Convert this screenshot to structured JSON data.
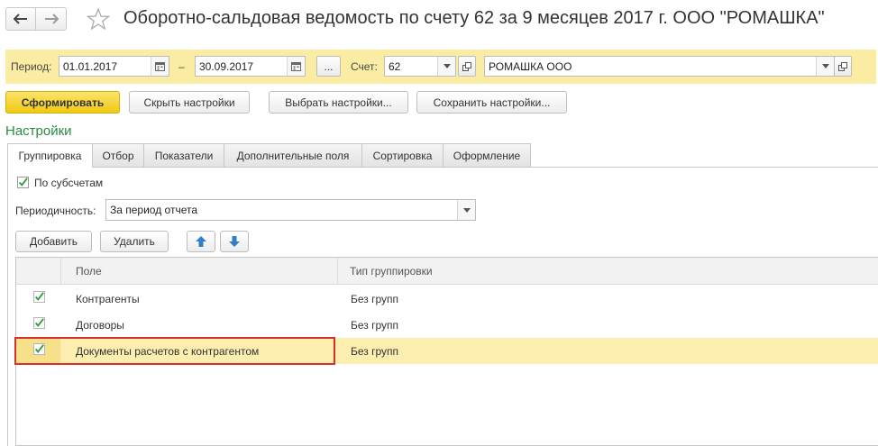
{
  "window": {
    "title": "Оборотно-сальдовая ведомость по счету 62 за 9 месяцев 2017 г. ООО \"РОМАШКА\"",
    "back_icon": "arrow-left-icon",
    "forward_icon": "arrow-right-icon",
    "favorite_icon": "star-icon"
  },
  "params": {
    "period_label": "Период:",
    "date_from": "01.01.2017",
    "dash": "–",
    "date_to": "30.09.2017",
    "ellipsis_label": "...",
    "account_label": "Счет:",
    "account_value": "62",
    "org_value": "РОМАШКА ООО"
  },
  "toolbar": {
    "generate": "Сформировать",
    "hide_settings": "Скрыть настройки",
    "choose_settings": "Выбрать настройки...",
    "save_settings": "Сохранить настройки..."
  },
  "settings": {
    "title": "Настройки",
    "tabs": [
      "Группировка",
      "Отбор",
      "Показатели",
      "Дополнительные поля",
      "Сортировка",
      "Оформление"
    ],
    "active_tab": "Группировка",
    "by_subaccounts_label": "По субсчетам",
    "by_subaccounts_checked": true,
    "periodicity_label": "Периодичность:",
    "periodicity_value": "За период отчета",
    "add_button": "Добавить",
    "delete_button": "Удалить",
    "move_up_icon": "arrow-up-icon",
    "move_down_icon": "arrow-down-icon"
  },
  "grouping_table": {
    "columns": [
      "Поле",
      "Тип группировки"
    ],
    "rows": [
      {
        "checked": true,
        "field": "Контрагенты",
        "type": "Без групп"
      },
      {
        "checked": true,
        "field": "Договоры",
        "type": "Без групп"
      },
      {
        "checked": true,
        "field": "Документы расчетов с контрагентом",
        "type": "Без групп",
        "selected": true
      }
    ]
  },
  "colors": {
    "accent_yellow": "#fbeca4",
    "section_green": "#2b8a3e",
    "highlight_red": "#d9302c",
    "check_green": "#2e9b3c"
  }
}
